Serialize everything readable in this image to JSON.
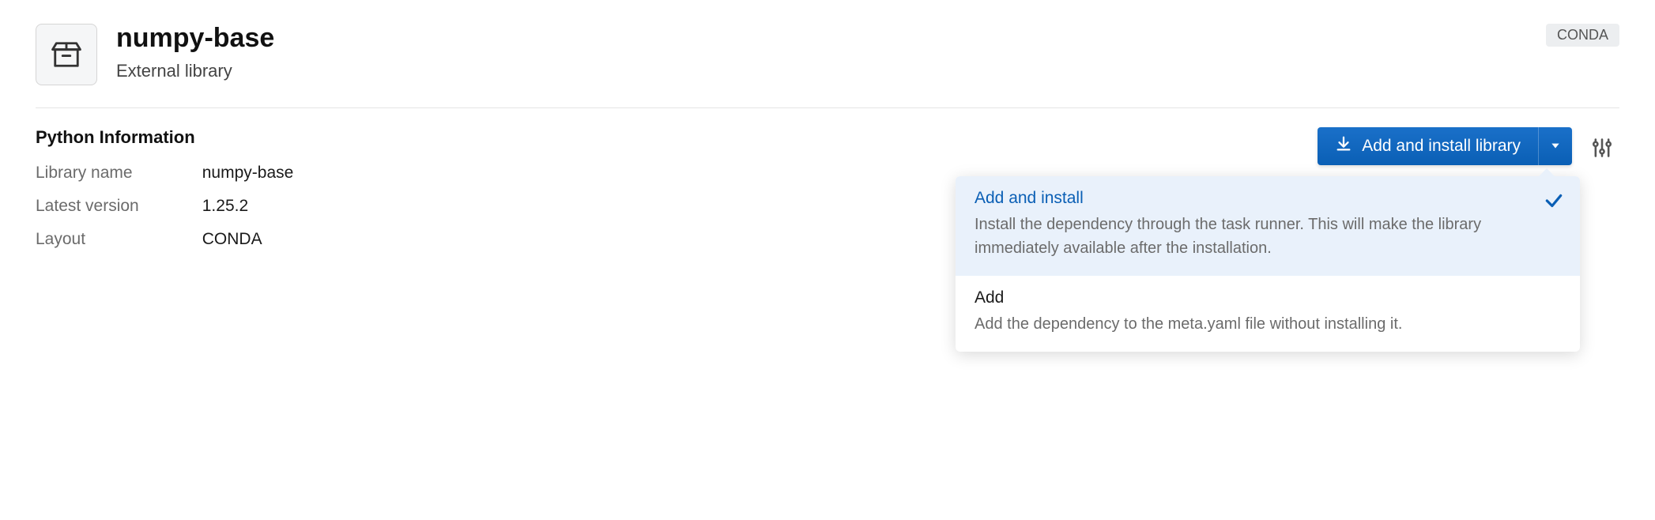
{
  "header": {
    "title": "numpy-base",
    "subtitle": "External library",
    "badge": "CONDA"
  },
  "info": {
    "heading": "Python Information",
    "rows": [
      {
        "label": "Library name",
        "value": "numpy-base"
      },
      {
        "label": "Latest version",
        "value": "1.25.2"
      },
      {
        "label": "Layout",
        "value": "CONDA"
      }
    ]
  },
  "actions": {
    "add_install_label": "Add and install library"
  },
  "dropdown": {
    "items": [
      {
        "title": "Add and install",
        "desc": "Install the dependency through the task runner. This will make the library immediately available after the installation.",
        "selected": true
      },
      {
        "title": "Add",
        "desc": "Add the dependency to the meta.yaml file without installing it.",
        "selected": false
      }
    ]
  }
}
